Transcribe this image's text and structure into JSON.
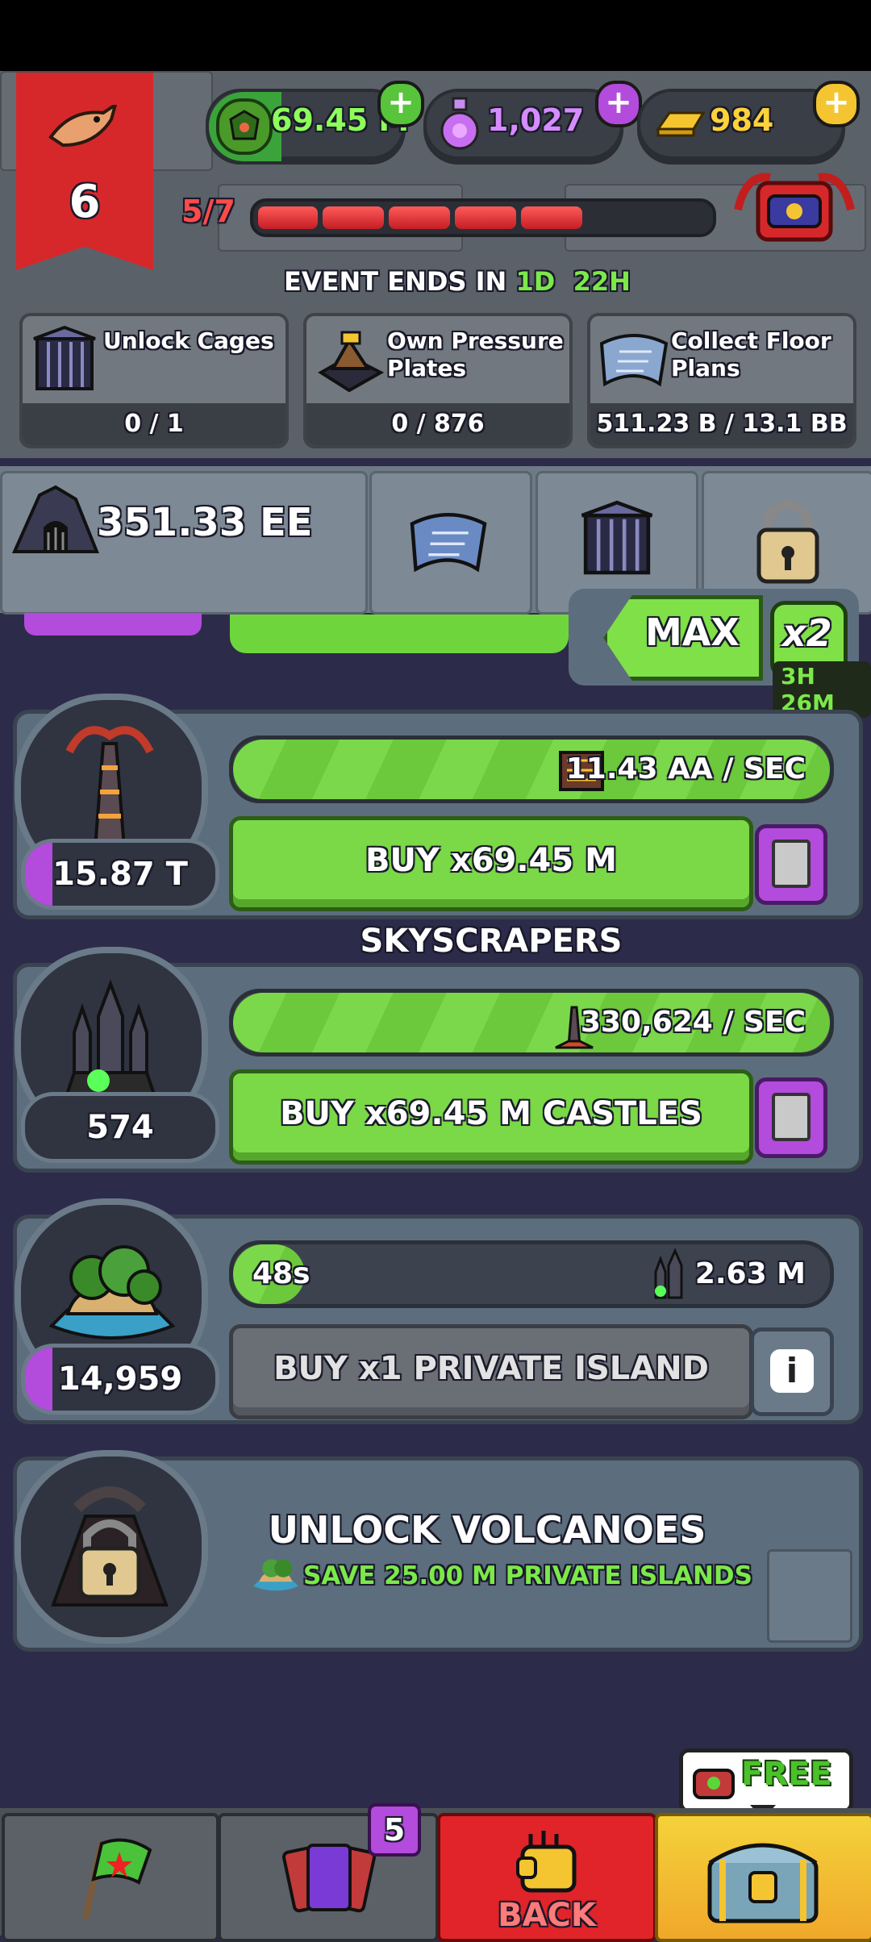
{
  "level": {
    "number": "6"
  },
  "currency": {
    "cash": "69.45 M",
    "potions": "1,027",
    "gold": "984"
  },
  "progress": {
    "label": "5/7",
    "filled": 5,
    "total": 7
  },
  "event": {
    "prefix": "EVENT ENDS IN ",
    "days": "1D",
    "hours": "22H"
  },
  "quests": [
    {
      "label": "Unlock Cages",
      "progress": "0 / 1"
    },
    {
      "label": "Own Pressure Plates",
      "progress": "0 / 876"
    },
    {
      "label": "Collect Floor Plans",
      "progress": "511.23 B / 13.1 BB"
    }
  ],
  "total_value": "351.33 EE",
  "max": {
    "label": "MAX",
    "multiplier": "x2",
    "timer": "3H 26M"
  },
  "buildings": [
    {
      "owned": "15.87 T",
      "rate": "11.43 AA / SEC",
      "buy_label": "BUY x69.45 M SKYSCRAPERS",
      "progress": 1.0
    },
    {
      "owned": "574",
      "rate": "330,624 / SEC",
      "buy_label": "BUY x69.45 M CASTLES",
      "progress": 1.0
    },
    {
      "owned": "14,959",
      "timer": "48s",
      "rate": "2.63 M",
      "buy_label": "BUY x1 PRIVATE ISLAND",
      "progress": 0.12
    }
  ],
  "locked": {
    "title": "UNLOCK VOLCANOES",
    "requirement": "SAVE 25.00 M PRIVATE ISLANDS"
  },
  "nav": {
    "cards_badge": "5",
    "back_label": "BACK",
    "free_label": "FREE"
  },
  "colors": {
    "accent_green": "#7bd948",
    "accent_purple": "#b34bdc",
    "accent_red": "#d6282b",
    "gold": "#f4c531"
  }
}
